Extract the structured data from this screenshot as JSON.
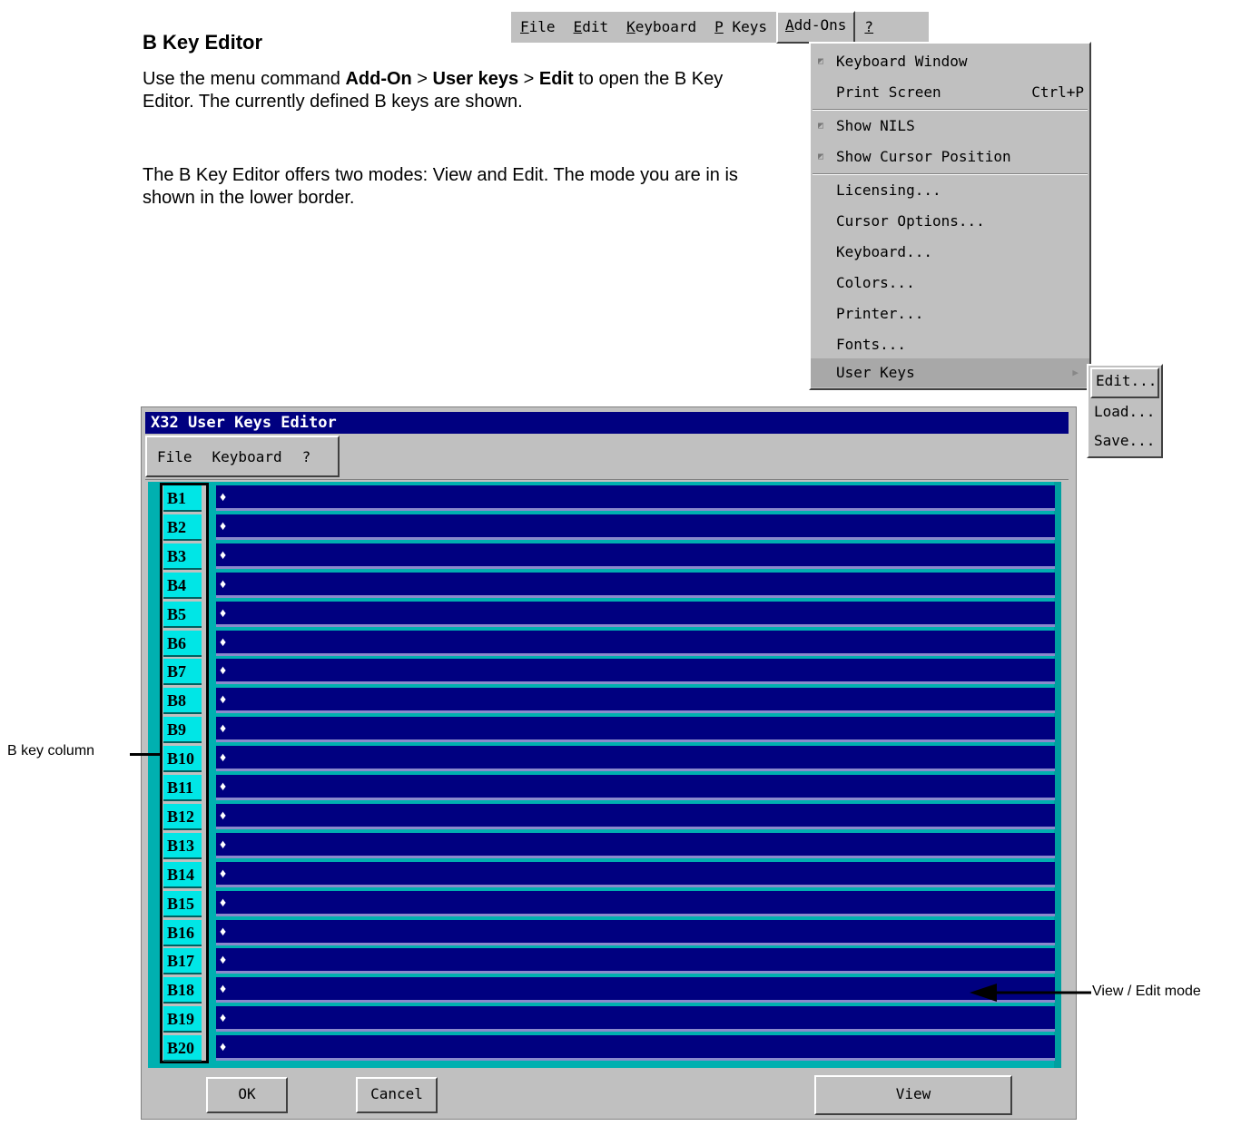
{
  "doc": {
    "heading": "B Key Editor",
    "para1": {
      "t1": "Use the menu command ",
      "b1": "Add-On",
      "t2": " > ",
      "b2": "User keys",
      "t3": " > ",
      "b3": "Edit",
      "t4": " to open the B Key Editor. The currently defined B keys are shown."
    },
    "para2": "The B Key Editor offers two modes: View and Edit. The mode you are in is shown in the lower border."
  },
  "terminal_menu": {
    "items": [
      {
        "first": "F",
        "rest": "ile"
      },
      {
        "first": "E",
        "rest": "dit"
      },
      {
        "first": "K",
        "rest": "eyboard"
      },
      {
        "first": "P",
        "rest": " Keys"
      },
      {
        "first": "A",
        "rest": "dd-Ons"
      },
      {
        "first": "?",
        "rest": ""
      }
    ]
  },
  "addons_dropdown": {
    "keyboard_window": "Keyboard Window",
    "print_screen": "Print Screen",
    "print_screen_accel": "Ctrl+P",
    "show_nils": "Show NILS",
    "show_cursor_position": "Show Cursor Position",
    "licensing": "Licensing...",
    "cursor_options": "Cursor Options...",
    "keyboard": "Keyboard...",
    "colors": "Colors...",
    "printer": "Printer...",
    "fonts": "Fonts...",
    "user_keys": "User Keys"
  },
  "user_keys_submenu": {
    "edit": "Edit...",
    "load": "Load...",
    "save": "Save..."
  },
  "editor": {
    "title": "X32 User Keys Editor",
    "menu": [
      "File",
      "Keyboard",
      "?"
    ],
    "keys": [
      "B1",
      "B2",
      "B3",
      "B4",
      "B5",
      "B6",
      "B7",
      "B8",
      "B9",
      "B10",
      "B11",
      "B12",
      "B13",
      "B14",
      "B15",
      "B16",
      "B17",
      "B18",
      "B19",
      "B20"
    ],
    "field_marker": "♦",
    "ok": "OK",
    "cancel": "Cancel",
    "mode": "View"
  },
  "callouts": {
    "b_key_column": "B key column",
    "view_edit_mode": "View / Edit mode"
  }
}
